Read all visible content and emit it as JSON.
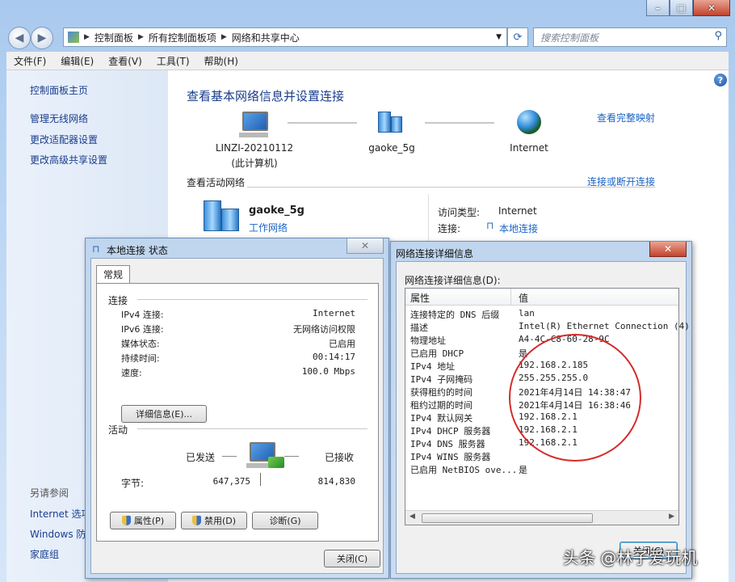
{
  "address": {
    "crumbs": [
      "控制面板",
      "所有控制面板项",
      "网络和共享中心"
    ],
    "search_placeholder": "搜索控制面板"
  },
  "menu": [
    "文件(F)",
    "编辑(E)",
    "查看(V)",
    "工具(T)",
    "帮助(H)"
  ],
  "left_pane": {
    "home": "控制面板主页",
    "links": [
      "管理无线网络",
      "更改适配器设置",
      "更改高级共享设置"
    ],
    "see_also_title": "另请参阅",
    "see_also": [
      "Internet 选项",
      "Windows 防",
      "家庭组"
    ]
  },
  "main": {
    "title": "查看基本网络信息并设置连接",
    "view_full_map": "查看完整映射",
    "map": {
      "computer_name": "LINZI-20210112",
      "computer_sub": "(此计算机)",
      "network": "gaoke_5g",
      "internet": "Internet"
    },
    "active_title": "查看活动网络",
    "connect_link": "连接或断开连接",
    "active": {
      "name": "gaoke_5g",
      "type": "工作网络",
      "access_label": "访问类型:",
      "access_value": "Internet",
      "conn_label": "连接:",
      "conn_value": "本地连接"
    }
  },
  "status_dialog": {
    "title": "本地连接 状态",
    "tab": "常规",
    "conn_group": "连接",
    "rows": [
      {
        "k": "IPv4 连接:",
        "v": "Internet"
      },
      {
        "k": "IPv6 连接:",
        "v": "无网络访问权限"
      },
      {
        "k": "媒体状态:",
        "v": "已启用"
      },
      {
        "k": "持续时间:",
        "v": "00:14:17"
      },
      {
        "k": "速度:",
        "v": "100.0 Mbps"
      }
    ],
    "details_btn": "详细信息(E)...",
    "activity_group": "活动",
    "sent_label": "已发送",
    "recv_label": "已接收",
    "bytes_label": "字节:",
    "bytes_sent": "647,375",
    "bytes_recv": "814,830",
    "btn_props": "属性(P)",
    "btn_disable": "禁用(D)",
    "btn_diag": "诊断(G)",
    "btn_close": "关闭(C)"
  },
  "details_dialog": {
    "title": "网络连接详细信息",
    "list_label": "网络连接详细信息(D):",
    "col_prop": "属性",
    "col_val": "值",
    "rows": [
      {
        "p": "连接特定的 DNS 后缀",
        "v": "lan"
      },
      {
        "p": "描述",
        "v": "Intel(R) Ethernet Connection (4)"
      },
      {
        "p": "物理地址",
        "v": "A4-4C-C8-60-28-9C"
      },
      {
        "p": "已启用 DHCP",
        "v": "是"
      },
      {
        "p": "IPv4 地址",
        "v": "192.168.2.185"
      },
      {
        "p": "IPv4 子网掩码",
        "v": "255.255.255.0"
      },
      {
        "p": "获得租约的时间",
        "v": "2021年4月14日 14:38:47"
      },
      {
        "p": "租约过期的时间",
        "v": "2021年4月14日 16:38:46"
      },
      {
        "p": "IPv4 默认网关",
        "v": "192.168.2.1"
      },
      {
        "p": "IPv4 DHCP 服务器",
        "v": "192.168.2.1"
      },
      {
        "p": "IPv4 DNS 服务器",
        "v": "192.168.2.1"
      },
      {
        "p": "IPv4 WINS 服务器",
        "v": ""
      },
      {
        "p": "已启用 NetBIOS ove...",
        "v": "是"
      }
    ],
    "close_btn": "关闭(C)"
  },
  "watermark": "头条 @林子爱玩机",
  "colors": {
    "link": "#1a63c5",
    "title": "#1a3d8c",
    "highlight": "#d52b2b"
  }
}
